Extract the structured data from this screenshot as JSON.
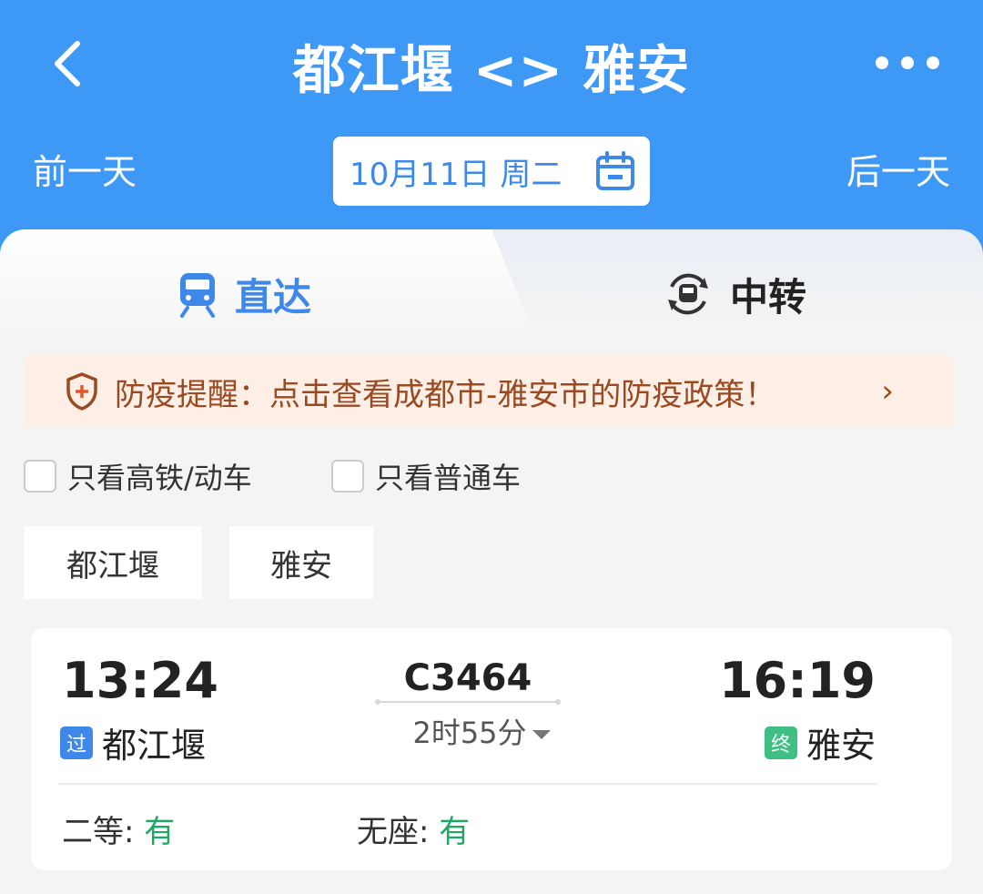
{
  "header": {
    "title": "都江堰 <> 雅安",
    "prev_day": "前一天",
    "next_day": "后一天",
    "date": "10月11日 周二",
    "bg_color": "#3d99f5"
  },
  "tabs": [
    {
      "label": "直达",
      "icon": "train-icon",
      "active": true
    },
    {
      "label": "中转",
      "icon": "transfer-train-icon",
      "active": false
    }
  ],
  "notice": {
    "text": "防疫提醒：点击查看成都市-雅安市的防疫政策！",
    "icon": "shield-plus-icon"
  },
  "filters": [
    {
      "label": "只看高铁/动车",
      "checked": false
    },
    {
      "label": "只看普通车",
      "checked": false
    }
  ],
  "stations": [
    "都江堰",
    "雅安"
  ],
  "trains": [
    {
      "departure_time": "13:24",
      "arrival_time": "16:19",
      "train_no": "C3464",
      "duration": "2时55分",
      "departure_badge": "过",
      "departure_station": "都江堰",
      "arrival_badge": "终",
      "arrival_station": "雅安",
      "seats": [
        {
          "label": "二等: ",
          "status": "有"
        },
        {
          "label": "无座: ",
          "status": "有"
        }
      ]
    }
  ]
}
